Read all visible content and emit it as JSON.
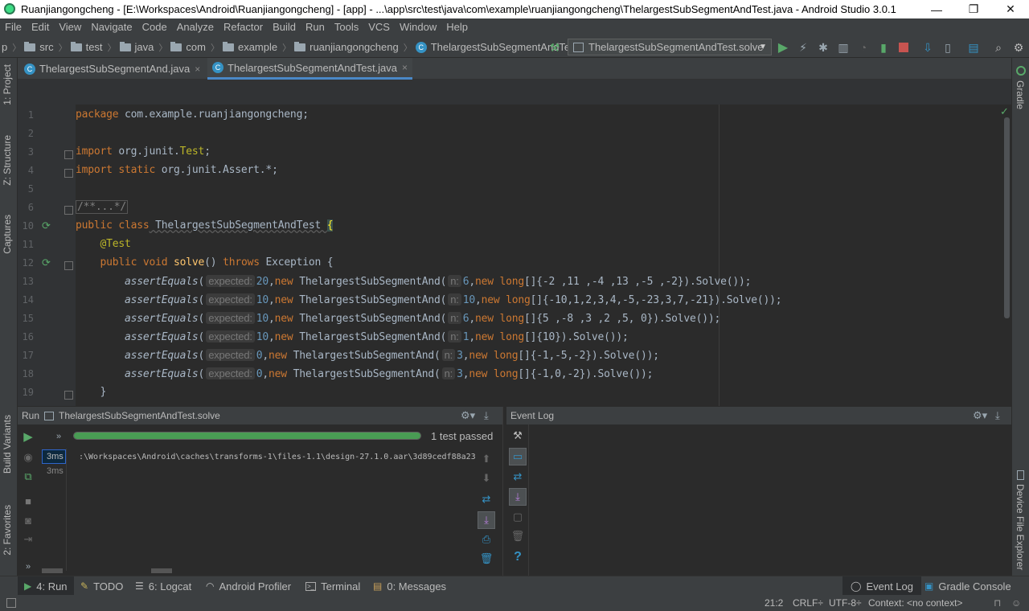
{
  "window": {
    "title": "Ruanjiangongcheng - [E:\\Workspaces\\Android\\Ruanjiangongcheng] - [app] - ...\\app\\src\\test\\java\\com\\example\\ruanjiangongcheng\\ThelargestSubSegmentAndTest.java - Android Studio 3.0.1",
    "minimize": "—",
    "maximize": "❐",
    "close": "✕"
  },
  "menu": [
    "File",
    "Edit",
    "View",
    "Navigate",
    "Code",
    "Analyze",
    "Refactor",
    "Build",
    "Run",
    "Tools",
    "VCS",
    "Window",
    "Help"
  ],
  "nav": {
    "lead": "p",
    "crumbs": [
      "src",
      "test",
      "java",
      "com",
      "example",
      "ruanjiangongcheng"
    ],
    "class_crumb": "ThelargestSubSegmentAndTest",
    "run_config": "ThelargestSubSegmentAndTest.solve"
  },
  "tabs": [
    {
      "label": "ThelargestSubSegmentAnd.java",
      "active": false
    },
    {
      "label": "ThelargestSubSegmentAndTest.java",
      "active": true
    }
  ],
  "left_stripe": {
    "project": "1: Project",
    "structure": "Z: Structure",
    "captures": "Captures",
    "build_variants": "Build Variants",
    "favorites": "2: Favorites"
  },
  "right_stripe": {
    "gradle": "Gradle",
    "device_explorer": "Device File Explorer"
  },
  "editor": {
    "line_numbers": [
      "1",
      "2",
      "3",
      "4",
      "5",
      "6",
      "10",
      "11",
      "12",
      "13",
      "14",
      "15",
      "16",
      "17",
      "18",
      "19"
    ],
    "code": {
      "l1_kw": "package",
      "l1_rest": " com.example.ruanjiangongcheng;",
      "l3_kw": "import",
      "l3_pkg": " org.junit.",
      "l3_cls": "Test",
      "l3_end": ";",
      "l4_kw": "import static",
      "l4_rest": " org.junit.Assert.*;",
      "l6_fold": "/**...*/",
      "l10_kw": "public class",
      "l10_name": " ThelargestSubSegmentAndTest ",
      "l10_brace": "{",
      "l11_ann": "    @Test",
      "l12_kw1": "    public void",
      "l12_name": " solve",
      "l12_parens": "() ",
      "l12_throws": "throws",
      "l12_rest": " Exception {",
      "assert_fn": "assertEquals",
      "hint_expected": "expected:",
      "hint_n": "n:",
      "new_kw": "new",
      "long_kw": "long",
      "l13_exp": "20",
      "l13_cls": "ThelargestSubSegmentAnd(",
      "l13_n": "6",
      "l13_arr": "[]{-2 ,11 ,-4 ,13 ,-5 ,-2}).Solve());",
      "l14_exp": "10",
      "l14_cls": "ThelargestSubSegmentAnd(",
      "l14_n": "10",
      "l14_arr": "[]{-10,1,2,3,4,-5,-23,3,7,-21}).Solve());",
      "l15_exp": "10",
      "l15_cls": "ThelargestSubSegmentAnd(",
      "l15_n": "6",
      "l15_arr": "[]{5 ,-8 ,3 ,2 ,5, 0}).Solve());",
      "l16_exp": "10",
      "l16_cls": "ThelargestSubSegmentAnd(",
      "l16_n": "1",
      "l16_arr": "[]{10}).Solve());",
      "l17_exp": "0",
      "l17_cls": "ThelargestSubSegmentAnd(",
      "l17_n": "3",
      "l17_arr": "[]{-1,-5,-2}).Solve());",
      "l18_exp": "0",
      "l18_cls": "ThelargestSubSegmentAnd(",
      "l18_n": "3",
      "l18_arr": "[]{-1,0,-2}).Solve());",
      "l19": "    }"
    }
  },
  "run_panel": {
    "label": "Run",
    "config": "ThelargestSubSegmentAndTest.solve",
    "status": "1 test passed",
    "progress": 1.0,
    "timings": [
      "3ms",
      "3ms"
    ],
    "output": ":\\Workspaces\\Android\\caches\\transforms-1\\files-1.1\\design-27.1.0.aar\\3d89cedf88a23"
  },
  "event_log": {
    "label": "Event Log"
  },
  "bottom_tools": [
    {
      "label": "4: Run",
      "icon": "run-icon"
    },
    {
      "label": "TODO",
      "icon": "todo-icon"
    },
    {
      "label": "6: Logcat",
      "icon": "logcat-icon"
    },
    {
      "label": "Android Profiler",
      "icon": "profiler-icon"
    },
    {
      "label": "Terminal",
      "icon": "terminal-icon"
    },
    {
      "label": "0: Messages",
      "icon": "messages-icon"
    },
    {
      "label": "Event Log",
      "icon": "event-log-icon"
    },
    {
      "label": "Gradle Console",
      "icon": "gradle-console-icon"
    }
  ],
  "status": {
    "position": "21:2",
    "line_sep": "CRLF÷",
    "encoding": "UTF-8÷",
    "context": "Context: <no context>"
  },
  "colors": {
    "accent": "#4a88c7",
    "pass": "#499c54",
    "keyword": "#cc7832",
    "number": "#6897bb",
    "annotation": "#bbb529"
  }
}
